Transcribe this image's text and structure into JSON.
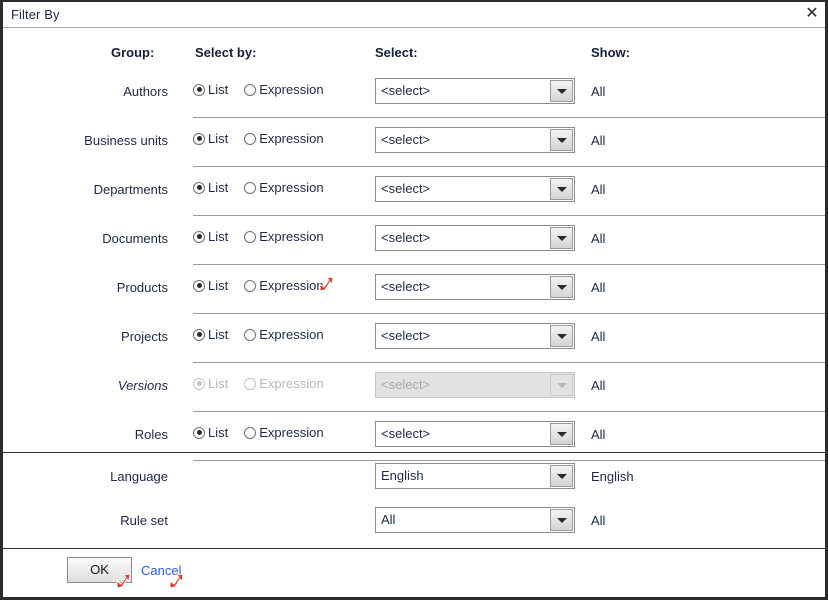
{
  "window": {
    "title": "Filter By",
    "close_icon": "close-icon",
    "close_glyph": "✕"
  },
  "columns": {
    "group": "Group:",
    "select_by": "Select by:",
    "select": "Select:",
    "show": "Show:"
  },
  "radio_options": {
    "list": "List",
    "expression": "Expression"
  },
  "rows": [
    {
      "label": "Authors",
      "selected": "list",
      "select_value": "<select>",
      "show": "All",
      "disabled": false
    },
    {
      "label": "Business units",
      "selected": "list",
      "select_value": "<select>",
      "show": "All",
      "disabled": false
    },
    {
      "label": "Departments",
      "selected": "list",
      "select_value": "<select>",
      "show": "All",
      "disabled": false
    },
    {
      "label": "Documents",
      "selected": "list",
      "select_value": "<select>",
      "show": "All",
      "disabled": false
    },
    {
      "label": "Products",
      "selected": "list",
      "select_value": "<select>",
      "show": "All",
      "disabled": false
    },
    {
      "label": "Projects",
      "selected": "list",
      "select_value": "<select>",
      "show": "All",
      "disabled": false
    },
    {
      "label": "Versions",
      "selected": "list",
      "select_value": "<select>",
      "show": "All",
      "disabled": true
    },
    {
      "label": "Roles",
      "selected": "list",
      "select_value": "<select>",
      "show": "All",
      "disabled": false
    }
  ],
  "bottom_rows": [
    {
      "label": "Language",
      "select_value": "English",
      "show": "English"
    },
    {
      "label": "Rule set",
      "select_value": "All",
      "show": "All"
    }
  ],
  "footer": {
    "ok_label": "OK",
    "cancel_label": "Cancel"
  },
  "markers": {
    "arrow_icon": "red-arrow-marker-icon",
    "color": "#e03a2f"
  },
  "colors": {
    "window_border": "#2b2b2b",
    "text": "#1b2a47",
    "link": "#2a5bd7",
    "separator": "#9a9a9a",
    "disabled_text": "#b9b9b9",
    "disabled_field": "#e2e2e2"
  }
}
